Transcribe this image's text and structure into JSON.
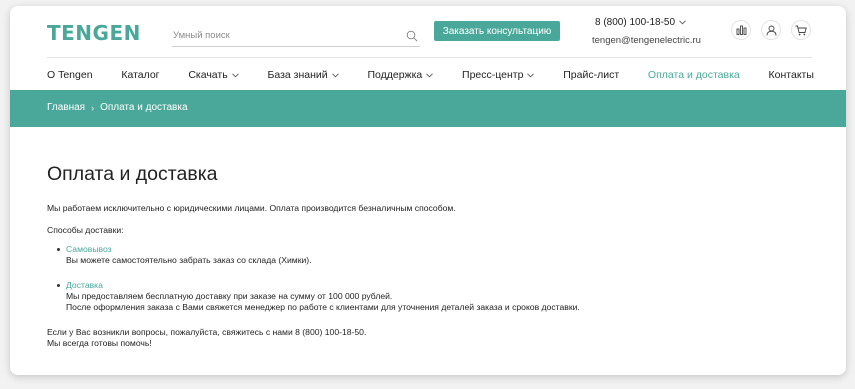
{
  "header": {
    "logo": "TENGEN",
    "search_placeholder": "Умный поиск",
    "consult_label": "Заказать консультацию",
    "phone": "8 (800) 100-18-50",
    "email": "tengen@tengenelectric.ru",
    "icons": [
      "compare-icon",
      "user-icon",
      "cart-icon"
    ]
  },
  "nav": {
    "items": [
      {
        "label": "О Tengen",
        "dropdown": false
      },
      {
        "label": "Каталог",
        "dropdown": false
      },
      {
        "label": "Скачать",
        "dropdown": true
      },
      {
        "label": "База знаний",
        "dropdown": true
      },
      {
        "label": "Поддержка",
        "dropdown": true
      },
      {
        "label": "Пресс-центр",
        "dropdown": true
      },
      {
        "label": "Прайс-лист",
        "dropdown": false
      },
      {
        "label": "Оплата и доставка",
        "dropdown": false,
        "active": true
      },
      {
        "label": "Контакты",
        "dropdown": false
      }
    ]
  },
  "breadcrumb": {
    "home": "Главная",
    "separator": "›",
    "current": "Оплата и доставка"
  },
  "page": {
    "title": "Оплата и доставка",
    "intro": "Мы работаем исключительно с юридическими лицами. Оплата производится безналичным способом.",
    "methods_label": "Способы доставки:",
    "methods": [
      {
        "title": "Самовывоз",
        "lines": [
          "Вы можете самостоятельно забрать заказ со склада (Химки)."
        ]
      },
      {
        "title": "Доставка",
        "lines": [
          "Мы предоставляем бесплатную доставку при заказе на сумму от 100 000 рублей.",
          "После оформления заказа с Вами свяжется менеджер по работе с клиентами для уточнения деталей заказа и сроков доставки."
        ]
      }
    ],
    "closing": [
      "Если у Вас возникли вопросы, пожалуйста, свяжитесь с нами 8 (800) 100-18-50.",
      "Мы всегда готовы помочь!"
    ]
  },
  "colors": {
    "accent": "#4aa89a",
    "text": "#222222"
  }
}
